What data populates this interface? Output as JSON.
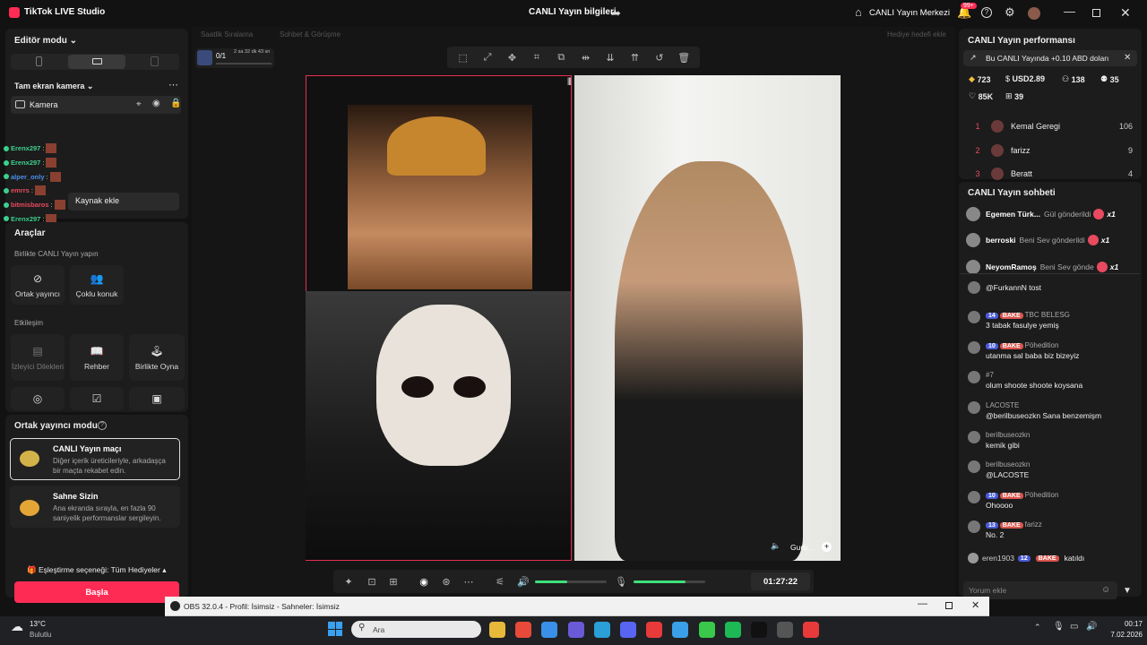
{
  "app": {
    "title": "TikTok LIVE Studio",
    "center_title": "CANLI Yayın bilgileri",
    "live_center": "CANLI Yayın Merkezi",
    "notif_count": "99+"
  },
  "left": {
    "editor_mode": "Editör modu",
    "scene": "Tam ekran kamera",
    "camera_source": "Kamera",
    "add_source": "Kaynak ekle",
    "overlay_chat": [
      {
        "user": "Erenx297",
        "color": "#3ecf8e"
      },
      {
        "user": "Erenx297",
        "color": "#3ecf8e"
      },
      {
        "user": "alper_only",
        "color": "#4a8fe7"
      },
      {
        "user": "emrrs",
        "color": "#e84a5f"
      },
      {
        "user": "bitmisbaros",
        "color": "#e84a5f"
      },
      {
        "user": "Erenx297",
        "color": "#3ecf8e"
      }
    ],
    "tools_title": "Araçlar",
    "together_title": "Birlikte CANLI Yayın yapın",
    "cohost": "Ortak yayıncı",
    "multiguest": "Çoklu konuk",
    "interaction_title": "Etkileşim",
    "viewer_requests": "İzleyici Dilekleri",
    "guide": "Rehber",
    "play_together": "Birlikte Oyna",
    "cohost_mode": "Ortak yayıncı modu",
    "match_title": "CANLI Yayın maçı",
    "match_desc": "Diğer içerik üreticileriyle, arkadaşça bir maçta rekabet edin.",
    "stage_title": "Sahne Sizin",
    "stage_desc": "Ana ekranda sırayla, en fazla 90 saniyelik performanslar sergileyin.",
    "match_pref": "Eşleştirme seçeneği: Tüm Hediyeler",
    "start": "Başla"
  },
  "center": {
    "tab1": "Saatlik Sıralama",
    "tab2": "Sohbet & Görüşme",
    "goal": "Hediye hedefi ekle",
    "counter": "0/1",
    "timer_small": "2 sa 32 dk 43 sn",
    "time": "01:27:22",
    "guest_label": "Gurb..."
  },
  "right": {
    "perf_title": "CANLI Yayın performansı",
    "perf_banner": "Bu CANLI Yayında +0.10 ABD doları",
    "stats": {
      "gems": "723",
      "usd": "USD2.89",
      "viewers": "138",
      "likes": "35",
      "views": "85K",
      "gifts": "39"
    },
    "ranking": [
      {
        "rank": "1",
        "name": "Kemal Geregi",
        "score": "106"
      },
      {
        "rank": "2",
        "name": "farizz",
        "score": "9"
      },
      {
        "rank": "3",
        "name": "Beratt",
        "score": "4"
      }
    ],
    "chat_title": "CANLI Yayın sohbeti",
    "gifts": [
      {
        "user": "Egemen Türk...",
        "action": "Gül gönderildi",
        "count": "x1"
      },
      {
        "user": "berroski",
        "action": "Beni Sev gönderildi",
        "count": "x1"
      },
      {
        "user": "NeyomRamoş",
        "action": "Beni Sev gönde",
        "count": "x1"
      }
    ],
    "messages": [
      {
        "user": "",
        "lvl": "",
        "tag": "",
        "text": "@FurkannN tost"
      },
      {
        "user": "TBC BELESG",
        "lvl": "14",
        "tag": "BAKE",
        "text": "3 tabak fasulye yemiş"
      },
      {
        "user": "Pöhedition",
        "lvl": "10",
        "tag": "BAKE",
        "text": "utanma sal baba biz bizeyiz"
      },
      {
        "user": "#7",
        "lvl": "",
        "tag": "",
        "text": "olum shoote shoote koysana"
      },
      {
        "user": "LACOSTE",
        "lvl": "",
        "tag": "",
        "text": "@berilbuseozkn Sana benzemişm"
      },
      {
        "user": "berilbuseozkn",
        "lvl": "",
        "tag": "",
        "text": "kemik gibi"
      },
      {
        "user": "berilbuseozkn",
        "lvl": "",
        "tag": "",
        "text": "@LACOSTE"
      },
      {
        "user": "Pöhedition",
        "lvl": "10",
        "tag": "BAKE",
        "text": "Ohoooo"
      },
      {
        "user": "farizz",
        "lvl": "13",
        "tag": "BAKE",
        "text": "No. 2"
      }
    ],
    "join": {
      "user": "eren1903",
      "lvl": "12",
      "tag": "BAKE",
      "text": "katıldı"
    },
    "comment_placeholder": "Yorum ekle"
  },
  "obs": {
    "title": "OBS 32.0.4 - Profil: İsimsiz - Sahneler: İsimsiz"
  },
  "taskbar": {
    "temp": "13°C",
    "weather": "Bulutlu",
    "search": "Ara",
    "time": "00:17",
    "date": "7.02.2026"
  }
}
